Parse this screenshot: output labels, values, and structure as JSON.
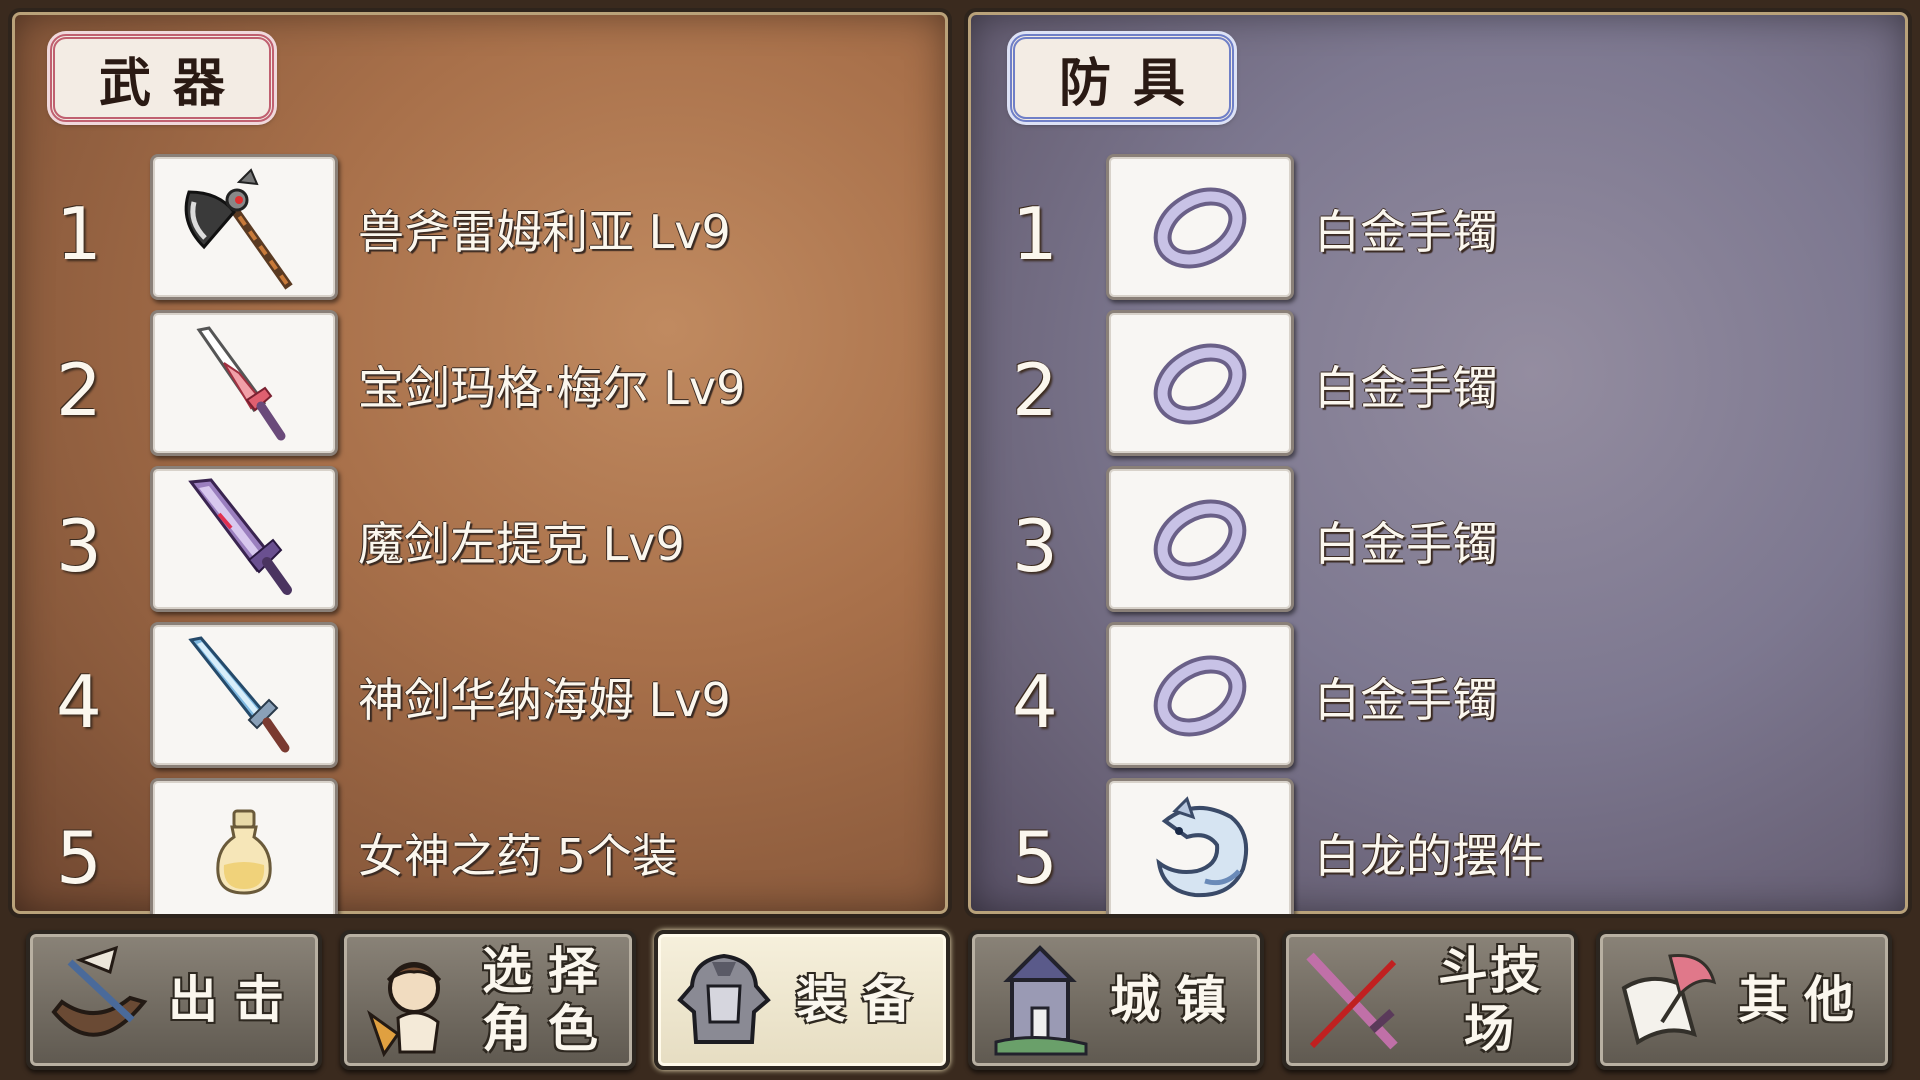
{
  "weapons": {
    "title": "武器",
    "items": [
      {
        "num": "1",
        "name": "兽斧雷姆利亚 Lv9",
        "icon": "axe-icon"
      },
      {
        "num": "2",
        "name": "宝剑玛格·梅尔 Lv9",
        "icon": "jeweled-sword-icon"
      },
      {
        "num": "3",
        "name": "魔剑左提克 Lv9",
        "icon": "demon-sword-icon"
      },
      {
        "num": "4",
        "name": "神剑华纳海姆 Lv9",
        "icon": "holy-sword-icon"
      },
      {
        "num": "5",
        "name": "女神之药 5个装",
        "icon": "potion-bottle-icon"
      }
    ]
  },
  "armor": {
    "title": "防具",
    "items": [
      {
        "num": "1",
        "name": "白金手镯",
        "icon": "platinum-bracelet-icon"
      },
      {
        "num": "2",
        "name": "白金手镯",
        "icon": "platinum-bracelet-icon"
      },
      {
        "num": "3",
        "name": "白金手镯",
        "icon": "platinum-bracelet-icon"
      },
      {
        "num": "4",
        "name": "白金手镯",
        "icon": "platinum-bracelet-icon"
      },
      {
        "num": "5",
        "name": "白龙的摆件",
        "icon": "white-dragon-figurine-icon"
      }
    ]
  },
  "nav": {
    "sortie": "出击",
    "select_line1": "选择",
    "select_line2": "角色",
    "equip": "装备",
    "town": "城镇",
    "arena": "斗技场",
    "other": "其他",
    "active": "equip"
  },
  "colors": {
    "weapons_accent": "#c06070",
    "armor_accent": "#6f7fc7",
    "weapons_bg": "#a8704a",
    "armor_bg": "#7d7890"
  }
}
